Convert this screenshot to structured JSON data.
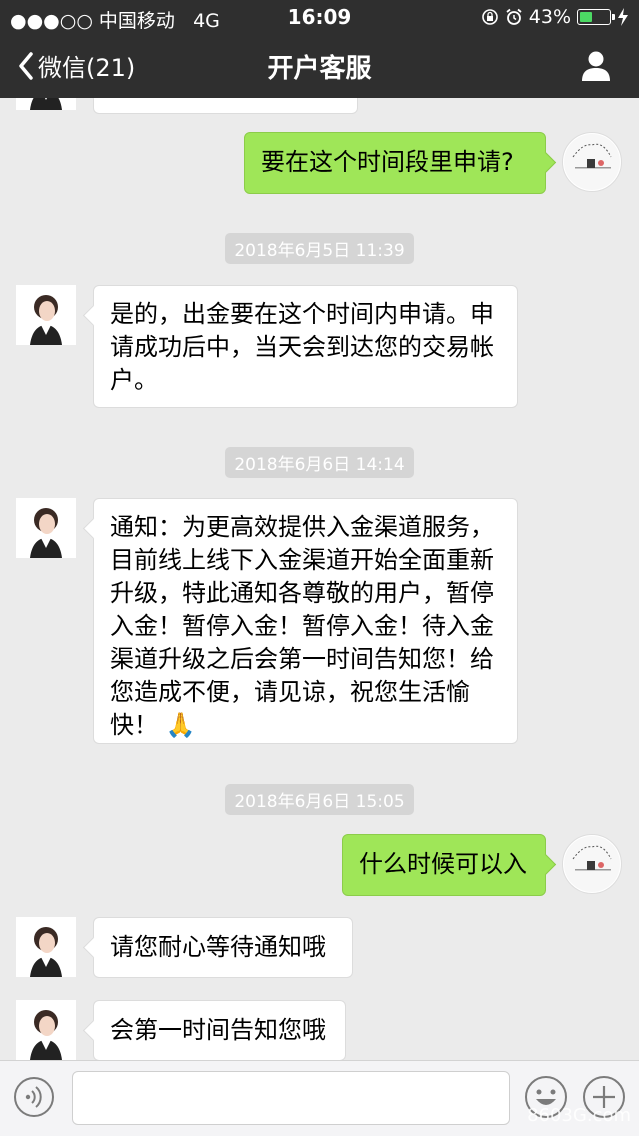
{
  "status_bar": {
    "carrier": "●●●○○ 中国移动",
    "network": "4G",
    "time": "16:09",
    "battery": "43%",
    "battery_fraction": 0.43,
    "icons": [
      "rotation-lock-icon",
      "alarm-icon",
      "battery-icon",
      "charging-bolt-icon"
    ]
  },
  "nav": {
    "back_label": "微信(21)",
    "title": "开户客服",
    "profile_icon": "person-icon"
  },
  "messages": [
    {
      "side": "right",
      "text": "要在这个时间段里申请?"
    },
    {
      "timestamp": "2018年6月5日 11:39"
    },
    {
      "side": "left",
      "text": "是的，出金要在这个时间内申请。申请成功后中，当天会到达您的交易帐户。"
    },
    {
      "timestamp": "2018年6月6日 14:14"
    },
    {
      "side": "left",
      "text": "通知：为更高效提供入金渠道服务，目前线上线下入金渠道开始全面重新升级，特此通知各尊敬的用户，暂停入金！暂停入金！暂停入金！待入金渠道升级之后会第一时间告知您！给您造成不便，请见谅，祝您生活愉快！ 🙏"
    },
    {
      "timestamp": "2018年6月6日 15:05"
    },
    {
      "side": "right",
      "text": "什么时候可以入"
    },
    {
      "side": "left",
      "text": "请您耐心等待通知哦"
    },
    {
      "side": "left",
      "text": "会第一时间告知您哦"
    }
  ],
  "input_bar": {
    "voice_icon": "voice-icon",
    "text_value": "",
    "emoji_icon": "emoji-icon",
    "plus_icon": "plus-icon"
  },
  "watermark": "8603G.com",
  "colors": {
    "nav_bg": "#2f2f2f",
    "my_bubble": "#9fe658",
    "chat_bg": "#ebebeb"
  }
}
